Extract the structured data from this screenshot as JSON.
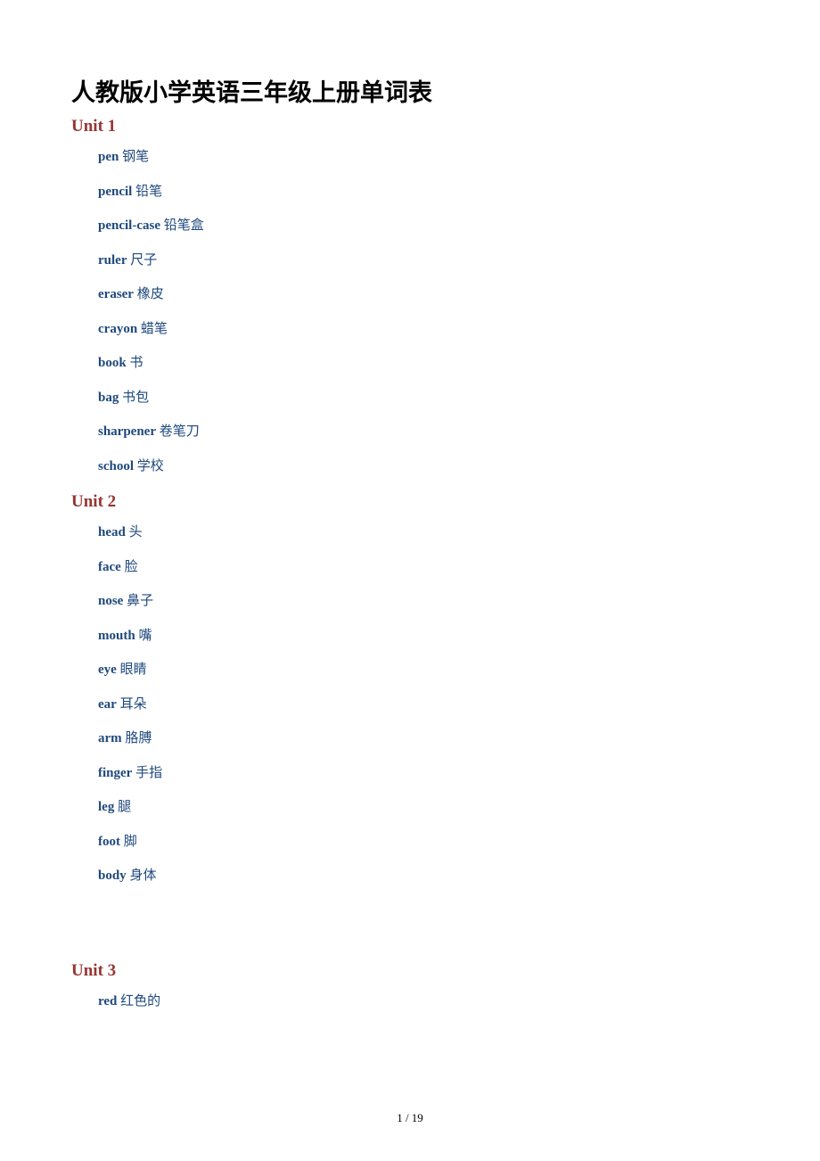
{
  "title": "人教版小学英语三年级上册单词表",
  "units": [
    {
      "heading": "Unit 1",
      "words": [
        {
          "en": "pen",
          "zh": "钢笔"
        },
        {
          "en": "pencil",
          "zh": "铅笔"
        },
        {
          "en": "pencil-case",
          "zh": "铅笔盒"
        },
        {
          "en": "ruler",
          "zh": "尺子"
        },
        {
          "en": "eraser",
          "zh": "橡皮"
        },
        {
          "en": "crayon",
          "zh": "蜡笔"
        },
        {
          "en": "book",
          "zh": "书"
        },
        {
          "en": "bag",
          "zh": "书包"
        },
        {
          "en": "sharpener",
          "zh": "卷笔刀"
        },
        {
          "en": "school",
          "zh": "学校"
        }
      ]
    },
    {
      "heading": "Unit 2",
      "words": [
        {
          "en": "head",
          "zh": "头"
        },
        {
          "en": "face",
          "zh": "脸"
        },
        {
          "en": "nose",
          "zh": "鼻子"
        },
        {
          "en": "mouth",
          "zh": "嘴"
        },
        {
          "en": "eye",
          "zh": "眼睛"
        },
        {
          "en": "ear",
          "zh": "耳朵"
        },
        {
          "en": "arm",
          "zh": "胳膊"
        },
        {
          "en": "finger",
          "zh": "手指"
        },
        {
          "en": "leg",
          "zh": "腿"
        },
        {
          "en": "foot",
          "zh": "脚"
        },
        {
          "en": "body",
          "zh": "身体"
        }
      ]
    },
    {
      "heading": "Unit 3",
      "words": [
        {
          "en": "red",
          "zh": "红色的"
        }
      ]
    }
  ],
  "footer": "1 / 19"
}
